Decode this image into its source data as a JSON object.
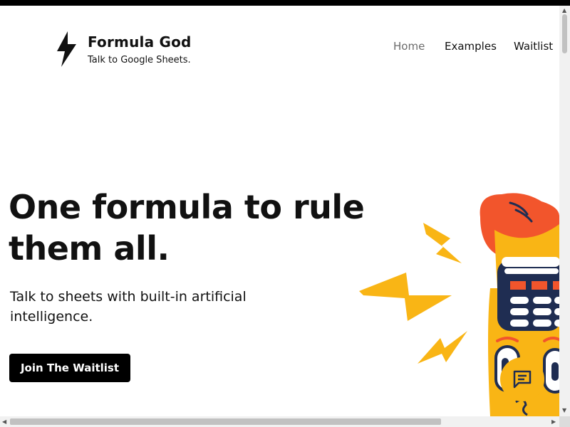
{
  "brand": {
    "name": "Formula God",
    "tagline": "Talk to Google Sheets.",
    "logo_icon": "lightning-bolt-icon"
  },
  "nav": {
    "items": [
      {
        "label": "Home",
        "active": true
      },
      {
        "label": "Examples",
        "active": false
      },
      {
        "label": "Waitlist",
        "active": false
      }
    ]
  },
  "hero": {
    "title": "One formula to rule them all.",
    "subtitle": "Talk to sheets with built-in artificial intelligence.",
    "cta_label": "Join The Waitlist"
  },
  "chat": {
    "icon": "chat-message-icon"
  },
  "colors": {
    "accent": "#f9b515",
    "dark": "#000000",
    "hair": "#f2552c",
    "navy": "#1f2d52"
  }
}
